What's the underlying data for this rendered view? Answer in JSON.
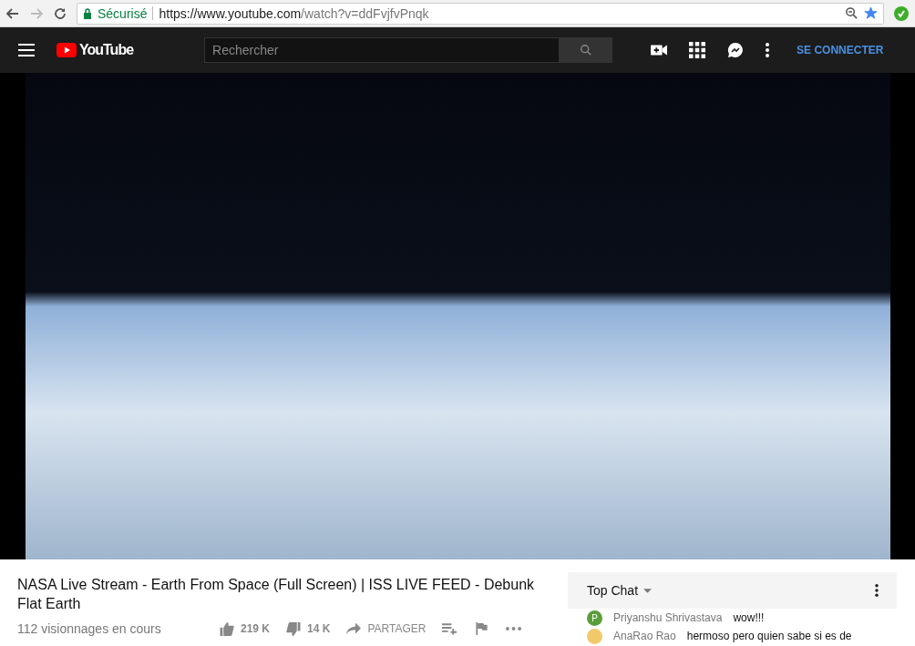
{
  "browser": {
    "security_label": "Sécurisé",
    "url_host": "https://www.youtube.com",
    "url_path": "/watch?v=ddFvjfvPnqk",
    "bookmarked": true
  },
  "header": {
    "logo_text": "YouTube",
    "search": {
      "placeholder": "Rechercher"
    },
    "sign_in": "SE CONNECTER"
  },
  "video": {
    "title": "NASA Live Stream - Earth From Space (Full Screen) | ISS LIVE FEED - Debunk Flat Earth",
    "views": "112 visionnages en cours",
    "likes": "219 K",
    "dislikes": "14 K",
    "share": "PARTAGER"
  },
  "chat": {
    "mode": "Top Chat",
    "messages": [
      {
        "initial": "P",
        "color": "#5a9e3a",
        "author": "Priyanshu Shrivastava",
        "text": "wow!!!"
      },
      {
        "color": "#f2c96a",
        "author": "AnaRao Rao",
        "text": "hermoso pero quien sabe si es de"
      }
    ]
  }
}
